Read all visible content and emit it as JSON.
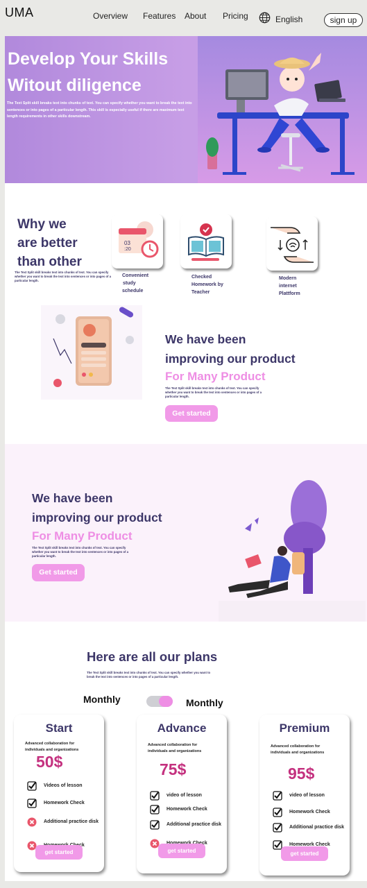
{
  "nav": {
    "logo": "UMA",
    "links": [
      "Overview",
      "Features",
      "About",
      "Pricing"
    ],
    "language": "English",
    "signup": "sign up"
  },
  "hero": {
    "title_line1": "Develop Your Skills",
    "title_line2": "Witout diligence",
    "text": "The Text Split skill breaks text into chunks of text. You can specify whether you want to break the text into sentences or into pages of a particular length. This skill is especially useful if there are maximum text length requirements in other skills downstream."
  },
  "why": {
    "title_line1": "Why we",
    "title_line2": "are better",
    "title_line3": "than other",
    "text": "The Text Split skill breaks text into chunks of text. You can specify whether you want to break the text into sentences or into pages of a particular length.",
    "features": [
      {
        "line1": "Convenient",
        "line2": "study",
        "line3": "schedule",
        "icon": "calendar-clock-icon"
      },
      {
        "line1": "Checked",
        "line2": "Homework by",
        "line3": "Teacher",
        "icon": "book-check-icon"
      },
      {
        "line1": "Modern",
        "line2": "internet",
        "line3": "Plattform",
        "icon": "hands-wifi-icon"
      }
    ]
  },
  "improve1": {
    "title_line1": "We have been",
    "title_line2": "improving our product",
    "accent": "For Many Product",
    "text": "The Text Split skill breaks text into chunks of text. You can specify whether you want to break the text into sentences or into pages of a particular length.",
    "cta": "Get started"
  },
  "improve2": {
    "title_line1": "We have been",
    "title_line2": "improving our product",
    "accent": "For Many Product",
    "text": "The Text Split skill breaks text into chunks of text. You can specify whether you want to break the text into sentences or into pages of a particular length.",
    "cta": "Get started"
  },
  "plans": {
    "title": "Here are all our plans",
    "text": "The Text Split skill breaks text into chunks of text. You can specify whether you want to break the text into sentences or into pages of a particular length.",
    "billing_left": "Monthly",
    "billing_right": "Monthly",
    "cards": [
      {
        "name": "Start",
        "desc": "Advanced collaboration for individuals and organizations",
        "price": "50$",
        "features": [
          {
            "label": "Videos of lesson",
            "included": true
          },
          {
            "label": "Homework Check",
            "included": true
          },
          {
            "label": "Additional practice disk",
            "included": false
          },
          {
            "label": "Homework Check",
            "included": false
          }
        ],
        "button": "get started"
      },
      {
        "name": "Advance",
        "desc": "Advanced collaboration for individuals and organizations",
        "price": "75$",
        "features": [
          {
            "label": "video of lesson",
            "included": true
          },
          {
            "label": "Homework Check",
            "included": true
          },
          {
            "label": "Additional practice disk",
            "included": true
          },
          {
            "label": "Homework Check",
            "included": false
          }
        ],
        "button": "get started"
      },
      {
        "name": "Premium",
        "desc": "Advanced collaboration for individuals and organizations",
        "price": "95$",
        "features": [
          {
            "label": "video of lesson",
            "included": true
          },
          {
            "label": "Homework Check",
            "included": true
          },
          {
            "label": "Additional practice disk",
            "included": true
          },
          {
            "label": "Homework Check",
            "included": true
          }
        ],
        "button": "get started"
      }
    ]
  },
  "colors": {
    "primary": "#3c3668",
    "accent_pink": "#ee8ee4",
    "button_pink": "#f19ae8",
    "price": "#c4317f",
    "hero_bg": "#c79ee6"
  }
}
